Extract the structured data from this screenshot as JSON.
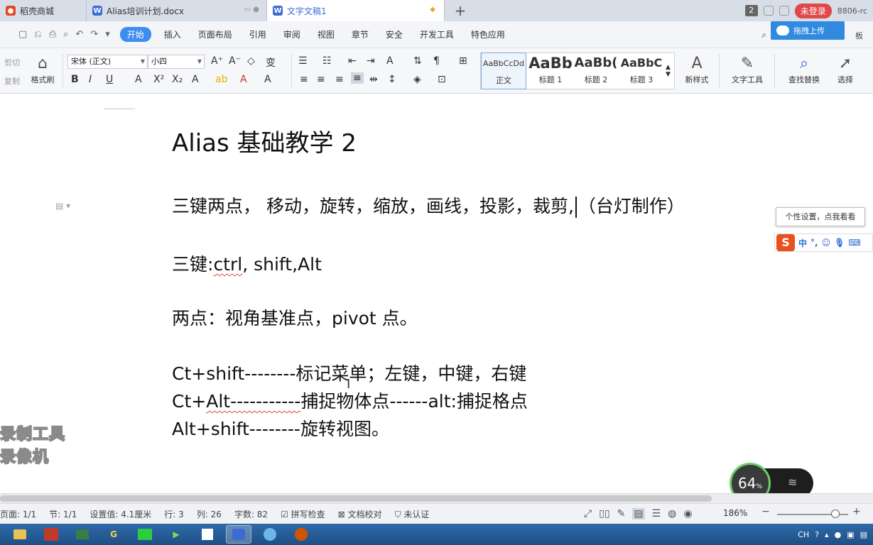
{
  "tabs": [
    {
      "label": "稻壳商城",
      "icon": "docer-icon",
      "color": "#e8451f"
    },
    {
      "label": "Alias培训计划.docx",
      "icon": "word-doc-icon",
      "color": "#3d6cd1"
    },
    {
      "label": "文字文稿1",
      "icon": "word-doc-icon",
      "color": "#3d6cd1"
    }
  ],
  "titlebar": {
    "new_tab": "+",
    "window_count": "2",
    "login_label": "未登录",
    "account": "8806-rc"
  },
  "menu": {
    "items": [
      "开始",
      "插入",
      "页面布局",
      "引用",
      "审阅",
      "视图",
      "章节",
      "安全",
      "开发工具",
      "特色应用"
    ],
    "upload_label": "拖拽上传",
    "template_label": "板"
  },
  "ribbon": {
    "cut": "剪切",
    "copy": "复制",
    "format_painter": "格式刷",
    "font_name": "宋体 (正文)",
    "font_size": "小四",
    "styles": [
      {
        "sample": "AaBbCcDd",
        "name": "正文"
      },
      {
        "sample": "AaBb",
        "name": "标题 1"
      },
      {
        "sample": "AaBb(",
        "name": "标题 2"
      },
      {
        "sample": "AaBbC",
        "name": "标题 3"
      }
    ],
    "new_style": "新样式",
    "text_tools": "文字工具",
    "find_replace": "查找替换",
    "select": "选择"
  },
  "document": {
    "title": "Alias  基础教学 2",
    "line1_a": "三键两点，    移动，旋转，缩放，画线，投影，裁剪,",
    "line1_b": "（台灯制作）",
    "line2_a": "三键:",
    "line2_b": "ctrl",
    "line2_c": ", shift,Alt",
    "line3": "两点：视角基准点，pivot  点。",
    "line4": "Ct+shift--------标记菜单；左键，中键，右键",
    "line5_a": "Ct+",
    "line5_b": "Alt-----------",
    "line5_c": "捕捉物体点------alt:捕捉格点",
    "line6": "Alt+shift--------旋转视图。"
  },
  "ime": {
    "tooltip": "个性设置，点我看看",
    "mode": "中",
    "punct": "°,"
  },
  "watermark": {
    "line1": "录制工具",
    "line2": "录像机"
  },
  "network": {
    "percent": "64",
    "unit": "%"
  },
  "status": {
    "page": "页面: 1/1",
    "section": "节: 1/1",
    "setting": "设置值: 4.1厘米",
    "row": "行: 3",
    "col": "列: 26",
    "wordcount": "字数: 82",
    "spellcheck": "拼写检查",
    "proofread": "文档校对",
    "cert": "未认证",
    "zoom": "186%",
    "zoom_minus": "−",
    "zoom_plus": "+"
  },
  "taskbar": {
    "ime_lang": "CH"
  }
}
